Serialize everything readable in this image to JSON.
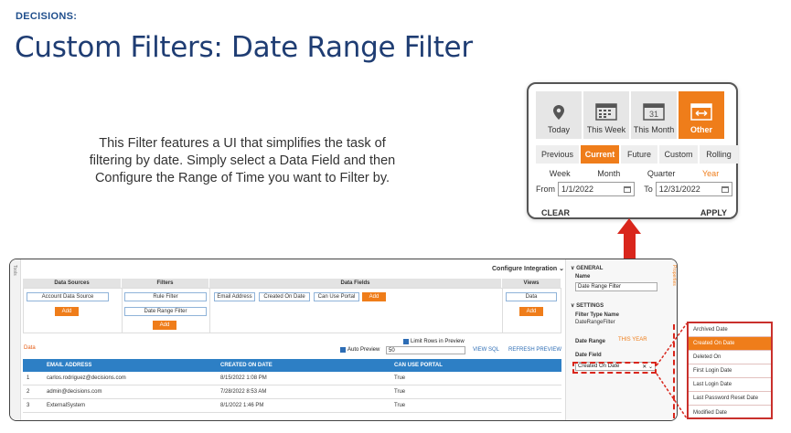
{
  "slide": {
    "tag": "DECISIONS:",
    "title": "Custom Filters: Date Range Filter",
    "description": "This Filter features a UI that simplifies the task of filtering by date. Simply select a Data Field and then Configure the Range of Time you want to Filter by."
  },
  "date_filter_popup": {
    "periods": [
      {
        "label": "Today",
        "icon": "map-pin-icon",
        "active": false
      },
      {
        "label": "This Week",
        "icon": "calendar-grid-icon",
        "active": false
      },
      {
        "label": "This Month",
        "icon": "calendar-31-icon",
        "active": false
      },
      {
        "label": "Other",
        "icon": "calendar-range-icon",
        "active": true
      }
    ],
    "calendar_day": "31",
    "scopes": [
      "Previous",
      "Current",
      "Future",
      "Custom",
      "Rolling"
    ],
    "active_scope": "Current",
    "units": [
      "Week",
      "Month",
      "Quarter",
      "Year"
    ],
    "active_unit": "Year",
    "from_label": "From",
    "from_value": "1/1/2022",
    "to_label": "To",
    "to_value": "12/31/2022",
    "clear_label": "CLEAR",
    "apply_label": "APPLY"
  },
  "designer": {
    "strip_label": "Tools",
    "configure_integration": "Configure Integration",
    "grid_columns": [
      "Data Sources",
      "Filters",
      "Data Fields",
      "Views"
    ],
    "data_source_chip": "Account Data Source",
    "filter_chips": [
      "Rule Filter",
      "Date Range Filter"
    ],
    "data_field_chips": [
      "Email Address",
      "Created On Date",
      "Can Use Portal"
    ],
    "view_chip": "Data",
    "add_label": "Add",
    "data_label": "Data",
    "limit_rows_label": "Limit Rows in Preview",
    "auto_preview_label": "Auto Preview",
    "rows_value": "50",
    "view_sql": "VIEW SQL",
    "refresh_preview": "REFRESH PREVIEW",
    "table_headers": [
      "",
      "EMAIL ADDRESS",
      "CREATED ON DATE",
      "CAN USE PORTAL"
    ],
    "rows": [
      {
        "num": "1",
        "email": "carlos.rodriguez@decisions.com",
        "date": "8/15/2022 1:08 PM",
        "portal": "True"
      },
      {
        "num": "2",
        "email": "admin@decisions.com",
        "date": "7/28/2022 8:53 AM",
        "portal": "True"
      },
      {
        "num": "3",
        "email": "ExternalSystem",
        "date": "8/1/2022 1:46 PM",
        "portal": "True"
      }
    ],
    "props": {
      "side_tab": "Properties",
      "general": "GENERAL",
      "name_label": "Name",
      "name_value": "Date Range Filter",
      "settings": "SETTINGS",
      "filter_type_label": "Filter Type Name",
      "filter_type_value": "DateRangeFilter",
      "date_range_label": "Date Range",
      "date_range_value": "THIS YEAR",
      "date_field_label": "Date Field",
      "date_field_value": "Created On Date"
    }
  },
  "date_field_options": [
    "Archived Date",
    "Created On Date",
    "Deleted On",
    "First Login Date",
    "Last Login Date",
    "Last Password Reset Date",
    "Modified Date"
  ],
  "selected_option": "Created On Date",
  "colors": {
    "accent": "#ef7d1a",
    "title": "#1f3d73",
    "arrow": "#d9261c",
    "table_header": "#2d7fc5"
  }
}
